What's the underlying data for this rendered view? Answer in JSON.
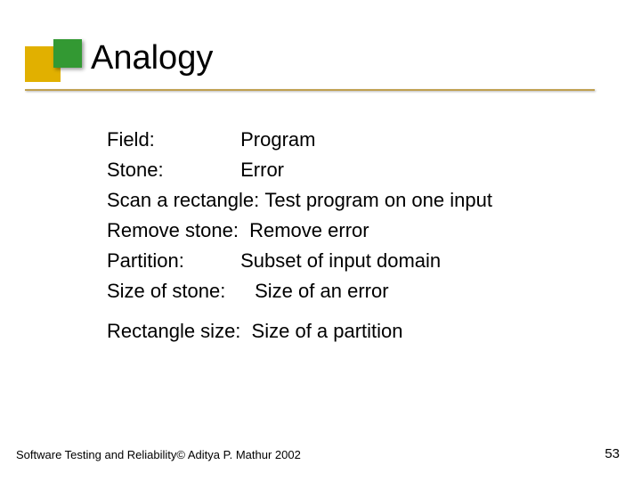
{
  "title": "Analogy",
  "rows": [
    {
      "label": "Field:",
      "value": "Program",
      "label_width": "144px"
    },
    {
      "label": "Stone:",
      "value": "Error",
      "label_width": "144px"
    },
    {
      "label": "Scan a  rectangle:",
      "value": "Test program on one input",
      "label_width": "auto"
    },
    {
      "label": "Remove stone:",
      "value": "Remove error",
      "label_width": "auto"
    },
    {
      "label": "Partition:",
      "value": "Subset of input domain",
      "label_width": "144px"
    },
    {
      "label": "Size of stone:",
      "value": "Size of an error",
      "label_width": "160px"
    }
  ],
  "extra_row": {
    "label": "Rectangle size:",
    "value": "Size of a partition",
    "label_width": "auto"
  },
  "footer_left": "Software Testing and Reliability© Aditya P. Mathur 2002",
  "footer_right": "53"
}
